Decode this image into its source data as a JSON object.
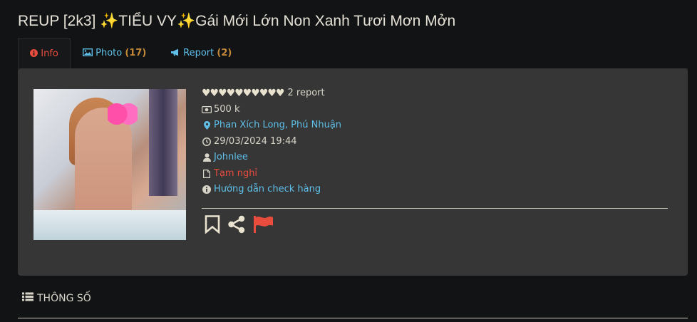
{
  "title": "REUP [2k3]  ✨TIỂU VY✨Gái Mới Lớn Non Xanh Tươi Mơn Mởn",
  "tabs": {
    "info": {
      "label": "Info"
    },
    "photo": {
      "label": "Photo",
      "count": "(17)"
    },
    "report": {
      "label": "Report",
      "count": "(2)"
    }
  },
  "listing": {
    "hearts": "♥♥♥♥♥♥♥♥♥♥",
    "report_count": "2 report",
    "price": "500 k",
    "location": "Phan Xích Long, Phú Nhuận",
    "datetime": "29/03/2024 19:44",
    "author": "Johnlee",
    "status": "Tạm nghỉ",
    "guide": "Hướng dẫn check hàng"
  },
  "section": {
    "label": "THÔNG SỐ"
  },
  "colors": {
    "accent_red": "#e84c3d",
    "link_blue": "#5fbfe8",
    "count_orange": "#c58a3a",
    "card_bg": "#363636"
  }
}
